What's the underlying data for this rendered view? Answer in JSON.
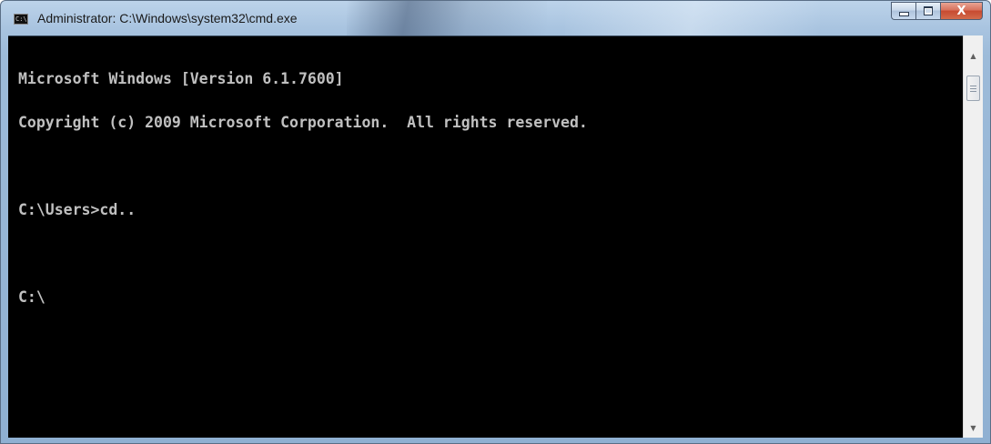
{
  "window": {
    "title": "Administrator: C:\\Windows\\system32\\cmd.exe",
    "icon": "cmd-icon",
    "icon_text": "C:\\",
    "buttons": {
      "minimize": "minimize-icon",
      "maximize": "maximize-icon",
      "close": "close-icon",
      "close_glyph": "X"
    }
  },
  "console": {
    "background": "#000000",
    "foreground": "#c0c0c0",
    "lines": [
      "Microsoft Windows [Version 6.1.7600]",
      "Copyright (c) 2009 Microsoft Corporation.  All rights reserved.",
      "",
      "C:\\Users>cd..",
      "",
      "C:\\"
    ]
  },
  "scrollbar": {
    "up_arrow": "▲",
    "down_arrow": "▼"
  }
}
